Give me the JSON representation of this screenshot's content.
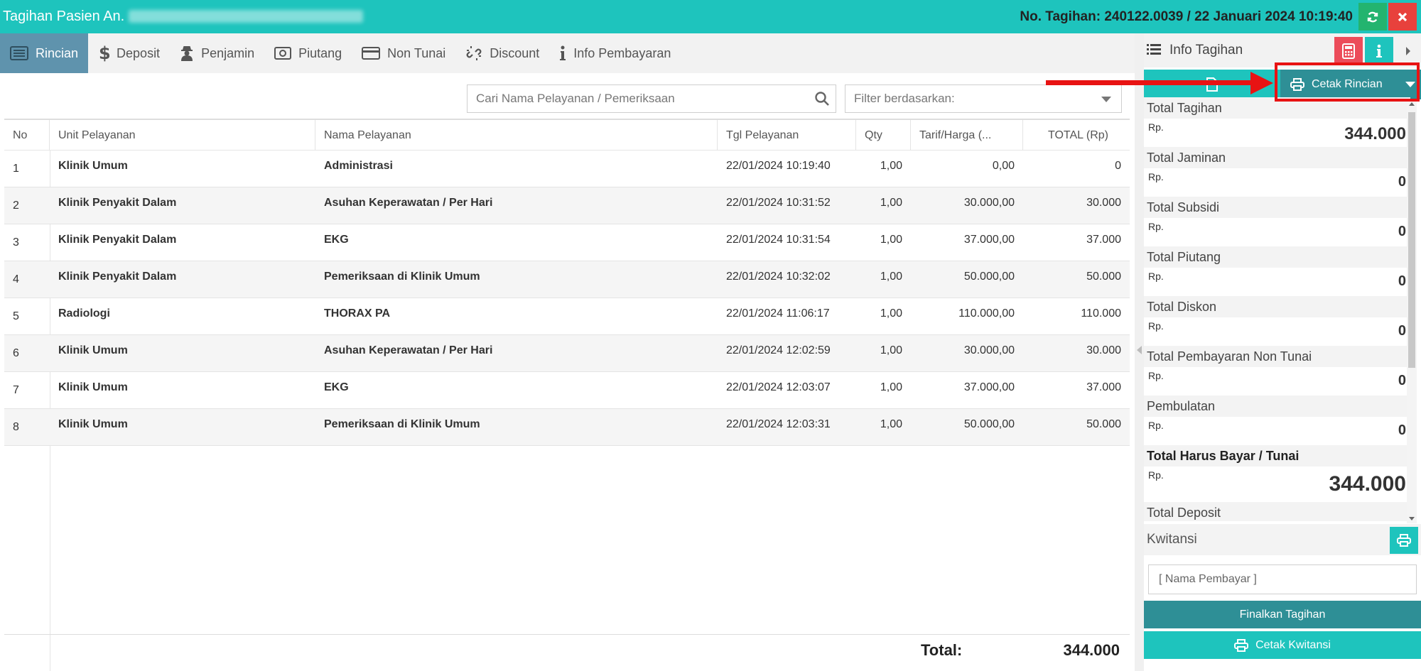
{
  "window": {
    "title": "Tagihan Pasien An.",
    "invoice": "No. Tagihan: 240122.0039 / 22 Januari 2024 10:19:40"
  },
  "tabs": [
    {
      "label": "Rincian",
      "icon": "list-icon",
      "active": true
    },
    {
      "label": "Deposit",
      "icon": "dollar-icon"
    },
    {
      "label": "Penjamin",
      "icon": "user-secret-icon"
    },
    {
      "label": "Piutang",
      "icon": "money-icon"
    },
    {
      "label": "Non Tunai",
      "icon": "credit-card-icon"
    },
    {
      "label": "Discount",
      "icon": "chain-broken-icon"
    },
    {
      "label": "Info Pembayaran",
      "icon": "info-icon"
    }
  ],
  "search": {
    "placeholder": "Cari Nama Pelayanan / Pemeriksaan"
  },
  "filter": {
    "placeholder": "Filter berdasarkan:"
  },
  "table": {
    "headers": [
      "No",
      "Unit Pelayanan",
      "Nama Pelayanan",
      "Tgl Pelayanan",
      "Qty",
      "Tarif/Harga (...",
      "TOTAL (Rp)"
    ],
    "rows": [
      {
        "no": "1",
        "unit": "Klinik Umum",
        "nama": "Administrasi",
        "tgl": "22/01/2024 10:19:40",
        "qty": "1,00",
        "tarif": "0,00",
        "total": "0"
      },
      {
        "no": "2",
        "unit": "Klinik Penyakit Dalam",
        "nama": "Asuhan Keperawatan / Per Hari",
        "tgl": "22/01/2024 10:31:52",
        "qty": "1,00",
        "tarif": "30.000,00",
        "total": "30.000"
      },
      {
        "no": "3",
        "unit": "Klinik Penyakit Dalam",
        "nama": "EKG",
        "tgl": "22/01/2024 10:31:54",
        "qty": "1,00",
        "tarif": "37.000,00",
        "total": "37.000"
      },
      {
        "no": "4",
        "unit": "Klinik Penyakit Dalam",
        "nama": "Pemeriksaan di Klinik Umum",
        "tgl": "22/01/2024 10:32:02",
        "qty": "1,00",
        "tarif": "50.000,00",
        "total": "50.000"
      },
      {
        "no": "5",
        "unit": "Radiologi",
        "nama": "THORAX PA",
        "tgl": "22/01/2024 11:06:17",
        "qty": "1,00",
        "tarif": "110.000,00",
        "total": "110.000"
      },
      {
        "no": "6",
        "unit": "Klinik Umum",
        "nama": "Asuhan Keperawatan / Per Hari",
        "tgl": "22/01/2024 12:02:59",
        "qty": "1,00",
        "tarif": "30.000,00",
        "total": "30.000"
      },
      {
        "no": "7",
        "unit": "Klinik Umum",
        "nama": "EKG",
        "tgl": "22/01/2024 12:03:07",
        "qty": "1,00",
        "tarif": "37.000,00",
        "total": "37.000"
      },
      {
        "no": "8",
        "unit": "Klinik Umum",
        "nama": "Pemeriksaan di Klinik Umum",
        "tgl": "22/01/2024 12:03:31",
        "qty": "1,00",
        "tarif": "50.000,00",
        "total": "50.000"
      }
    ],
    "footer_label": "Total:",
    "footer_value": "344.000"
  },
  "panel": {
    "title": "Info Tagihan",
    "print_detail_label": "Cetak Rincian",
    "summary": [
      {
        "label": "Total Tagihan",
        "currency": "Rp.",
        "value": "344.000",
        "size": "med"
      },
      {
        "label": "Total Jaminan",
        "currency": "Rp.",
        "value": "0"
      },
      {
        "label": "Total Subsidi",
        "currency": "Rp.",
        "value": "0"
      },
      {
        "label": "Total Piutang",
        "currency": "Rp.",
        "value": "0"
      },
      {
        "label": "Total Diskon",
        "currency": "Rp.",
        "value": "0"
      },
      {
        "label": "Total Pembayaran Non Tunai",
        "currency": "Rp.",
        "value": "0"
      },
      {
        "label": "Pembulatan",
        "currency": "Rp.",
        "value": "0"
      },
      {
        "label": "Total Harus Bayar / Tunai",
        "currency": "Rp.",
        "value": "344.000",
        "size": "big",
        "strong": true
      },
      {
        "label": "Total Deposit",
        "currency": "",
        "value": ""
      }
    ],
    "kwitansi_label": "Kwitansi",
    "payer_placeholder": "[ Nama Pembayar ]",
    "finalize_label": "Finalkan Tagihan",
    "print_receipt_label": "Cetak Kwitansi"
  },
  "colors": {
    "teal": "#1ec4bd",
    "dark_teal": "#2e8f96",
    "active_tab": "#5f93ad",
    "annotation_red": "#e81313"
  }
}
